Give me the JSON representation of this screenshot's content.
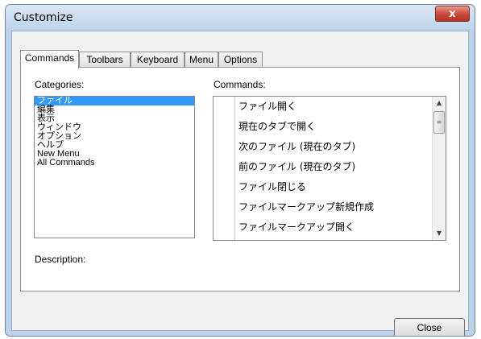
{
  "window": {
    "title": "Customize",
    "close_glyph": "x"
  },
  "tabs": [
    {
      "label": "Commands",
      "active": true
    },
    {
      "label": "Toolbars",
      "active": false
    },
    {
      "label": "Keyboard",
      "active": false
    },
    {
      "label": "Menu",
      "active": false
    },
    {
      "label": "Options",
      "active": false
    }
  ],
  "categories": {
    "label": "Categories:",
    "items": [
      "ファイル",
      "編集",
      "表示",
      "ウィンドウ",
      "オプション",
      "ヘルプ",
      "New Menu",
      "All Commands"
    ],
    "selected": "ファイル"
  },
  "commands": {
    "label": "Commands:",
    "items": [
      "ファイル開く",
      "現在のタブで開く",
      "次のファイル (現在のタブ)",
      "前のファイル (現在のタブ)",
      "ファイル閉じる",
      "ファイルマークアップ新規作成",
      "ファイルマークアップ開く"
    ]
  },
  "description": {
    "label": "Description:"
  },
  "buttons": {
    "close_label": "Close"
  },
  "colors": {
    "selection": "#3399ff",
    "titlebar": "#bcd3ea",
    "close_button": "#c9473a"
  },
  "icons": {
    "scroll_up": "chevron-up-icon",
    "scroll_down": "chevron-down-icon",
    "close": "close-icon"
  }
}
